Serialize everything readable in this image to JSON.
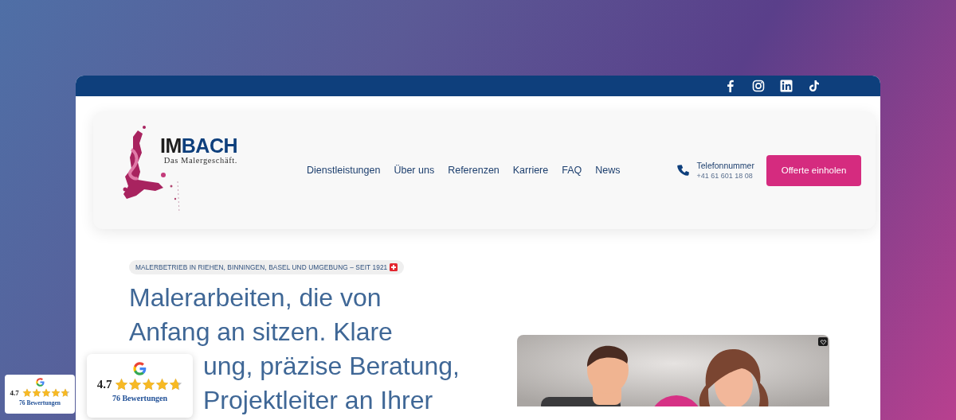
{
  "social_links": [
    {
      "kind": "facebook"
    },
    {
      "kind": "instagram"
    },
    {
      "kind": "linkedin"
    },
    {
      "kind": "tiktok"
    }
  ],
  "logo": {
    "mark_dark": "IM",
    "mark_blue": "BACH",
    "tagline": "Das Malergeschäft."
  },
  "nav": {
    "items": [
      "Dienstleistungen",
      "Über uns",
      "Referenzen",
      "Karriere",
      "FAQ",
      "News"
    ]
  },
  "contact": {
    "label": "Telefonnummer",
    "phone": "+41 61 601 18 08"
  },
  "cta_button": "Offerte einholen",
  "hero": {
    "eyebrow": "MALERBETRIEB IN RIEHEN, BINNINGEN, BASEL UND UMGEBUNG – SEIT 1921",
    "heading_lines": [
      {
        "text": "Malerarbeiten, die von",
        "covered": false
      },
      {
        "text": "Anfang an sitzen. Klare",
        "covered": false
      },
      {
        "text": "ung, präzise Beratung,",
        "covered": true
      },
      {
        "text": "Projektleiter an Ihrer",
        "covered": true
      }
    ]
  },
  "review_badges": [
    {
      "rating": "4.7",
      "stars": 4.7,
      "count": "76 Bewertungen"
    },
    {
      "rating": "4.7",
      "stars": 4.7,
      "count": "76 Bewertungen"
    }
  ]
}
